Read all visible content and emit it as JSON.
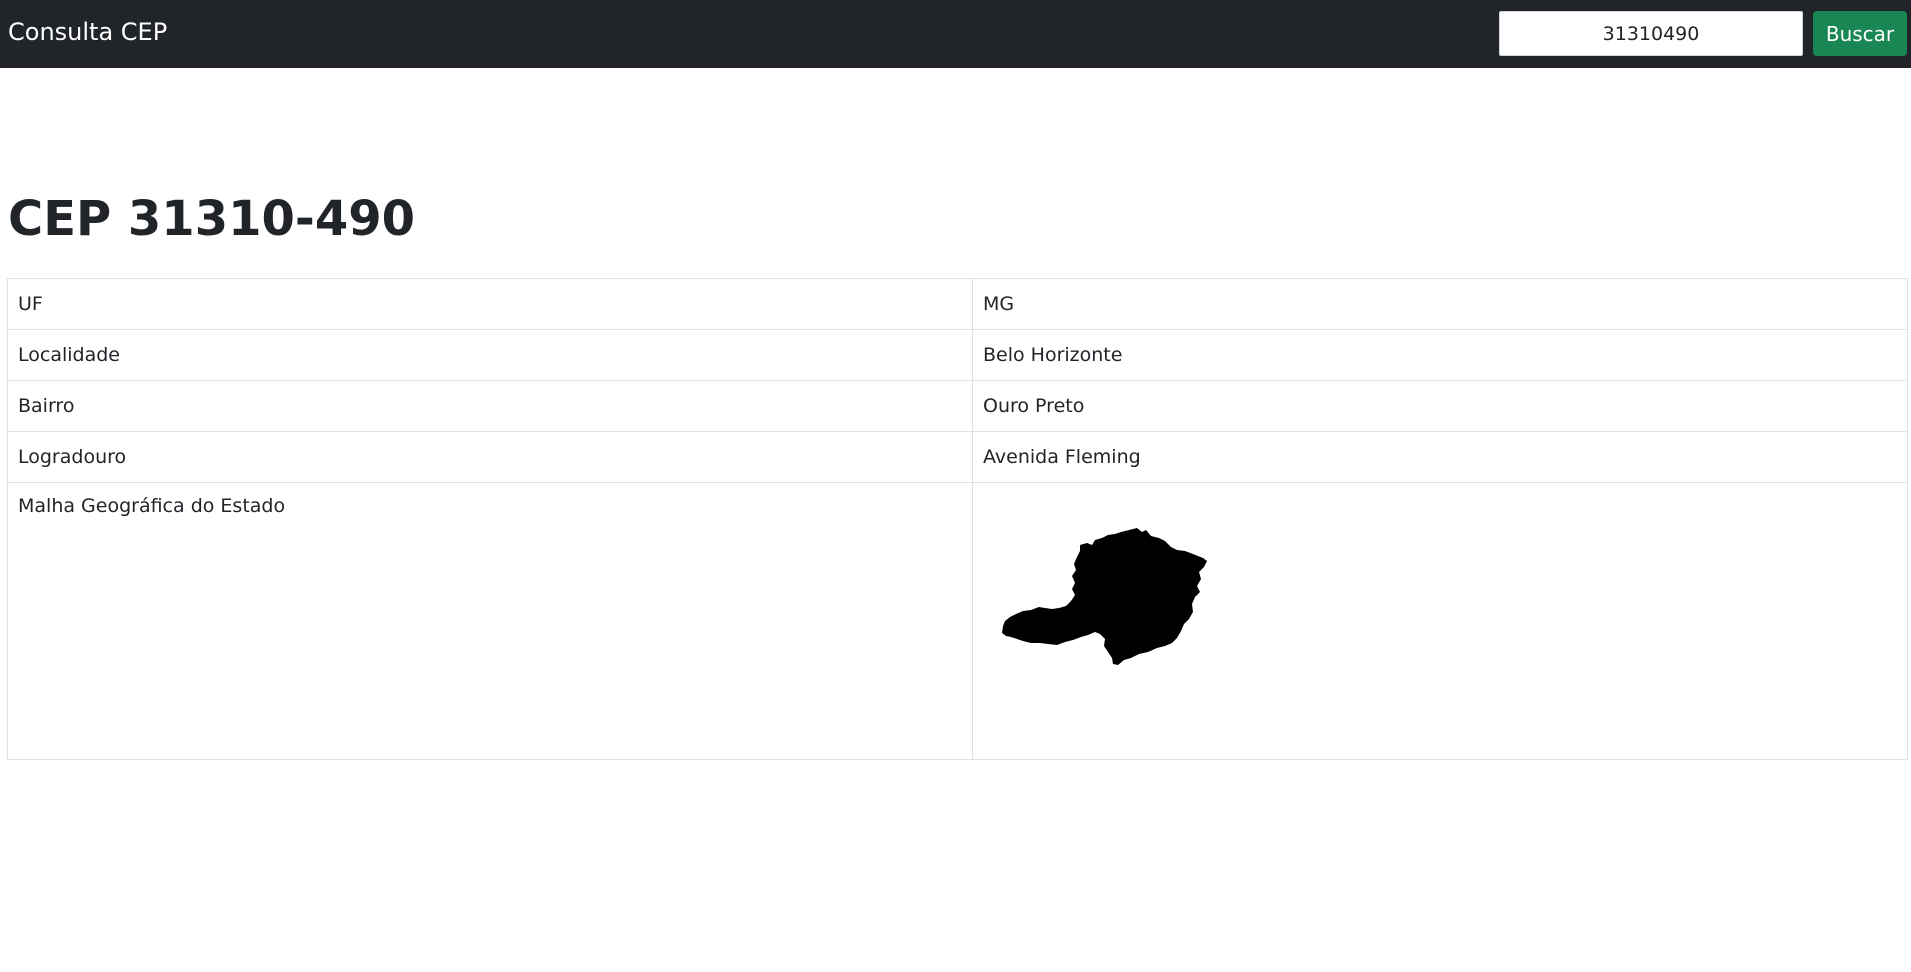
{
  "navbar": {
    "brand": "Consulta CEP",
    "search": {
      "value": "31310490",
      "placeholder": ""
    },
    "search_button_label": "Buscar"
  },
  "main": {
    "title": "CEP 31310-490",
    "rows": [
      {
        "label": "UF",
        "value": "MG"
      },
      {
        "label": "Localidade",
        "value": "Belo Horizonte"
      },
      {
        "label": "Bairro",
        "value": "Ouro Preto"
      },
      {
        "label": "Logradouro",
        "value": "Avenida Fleming"
      }
    ],
    "map_row_label": "Malha Geográfica do Estado",
    "map_image": "minas-gerais-state-map"
  },
  "colors": {
    "navbar_bg": "#212529",
    "button_bg": "#198754",
    "map_fill": "#000000"
  }
}
